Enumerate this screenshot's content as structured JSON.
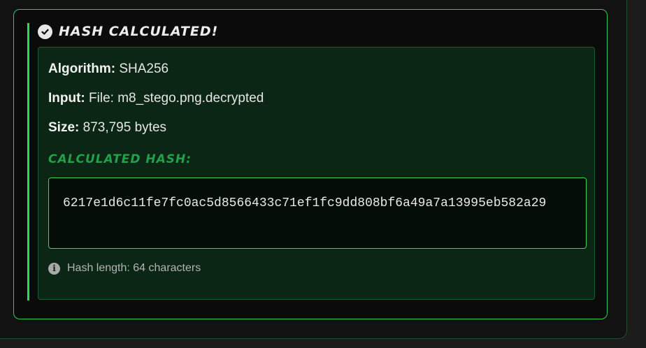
{
  "result": {
    "title": "HASH CALCULATED!",
    "status_icon": "check-circle-icon",
    "details": {
      "algorithm_label": "Algorithm:",
      "algorithm_value": "SHA256",
      "input_label": "Input:",
      "input_value": "File: m8_stego.png.decrypted",
      "size_label": "Size:",
      "size_value": "873,795 bytes"
    },
    "hash_heading": "CALCULATED HASH:",
    "hash_value": "6217e1d6c11fe7fc0ac5d8566433c71ef1fc9dd808bf6a49a7a13995eb582a29",
    "hash_info_icon": "info-circle-icon",
    "hash_info": "Hash length: 64 characters"
  },
  "colors": {
    "accent": "#27e04b",
    "card_border": "#2ecc55",
    "details_background": "#0b2614",
    "hash_heading": "#22a04a"
  }
}
